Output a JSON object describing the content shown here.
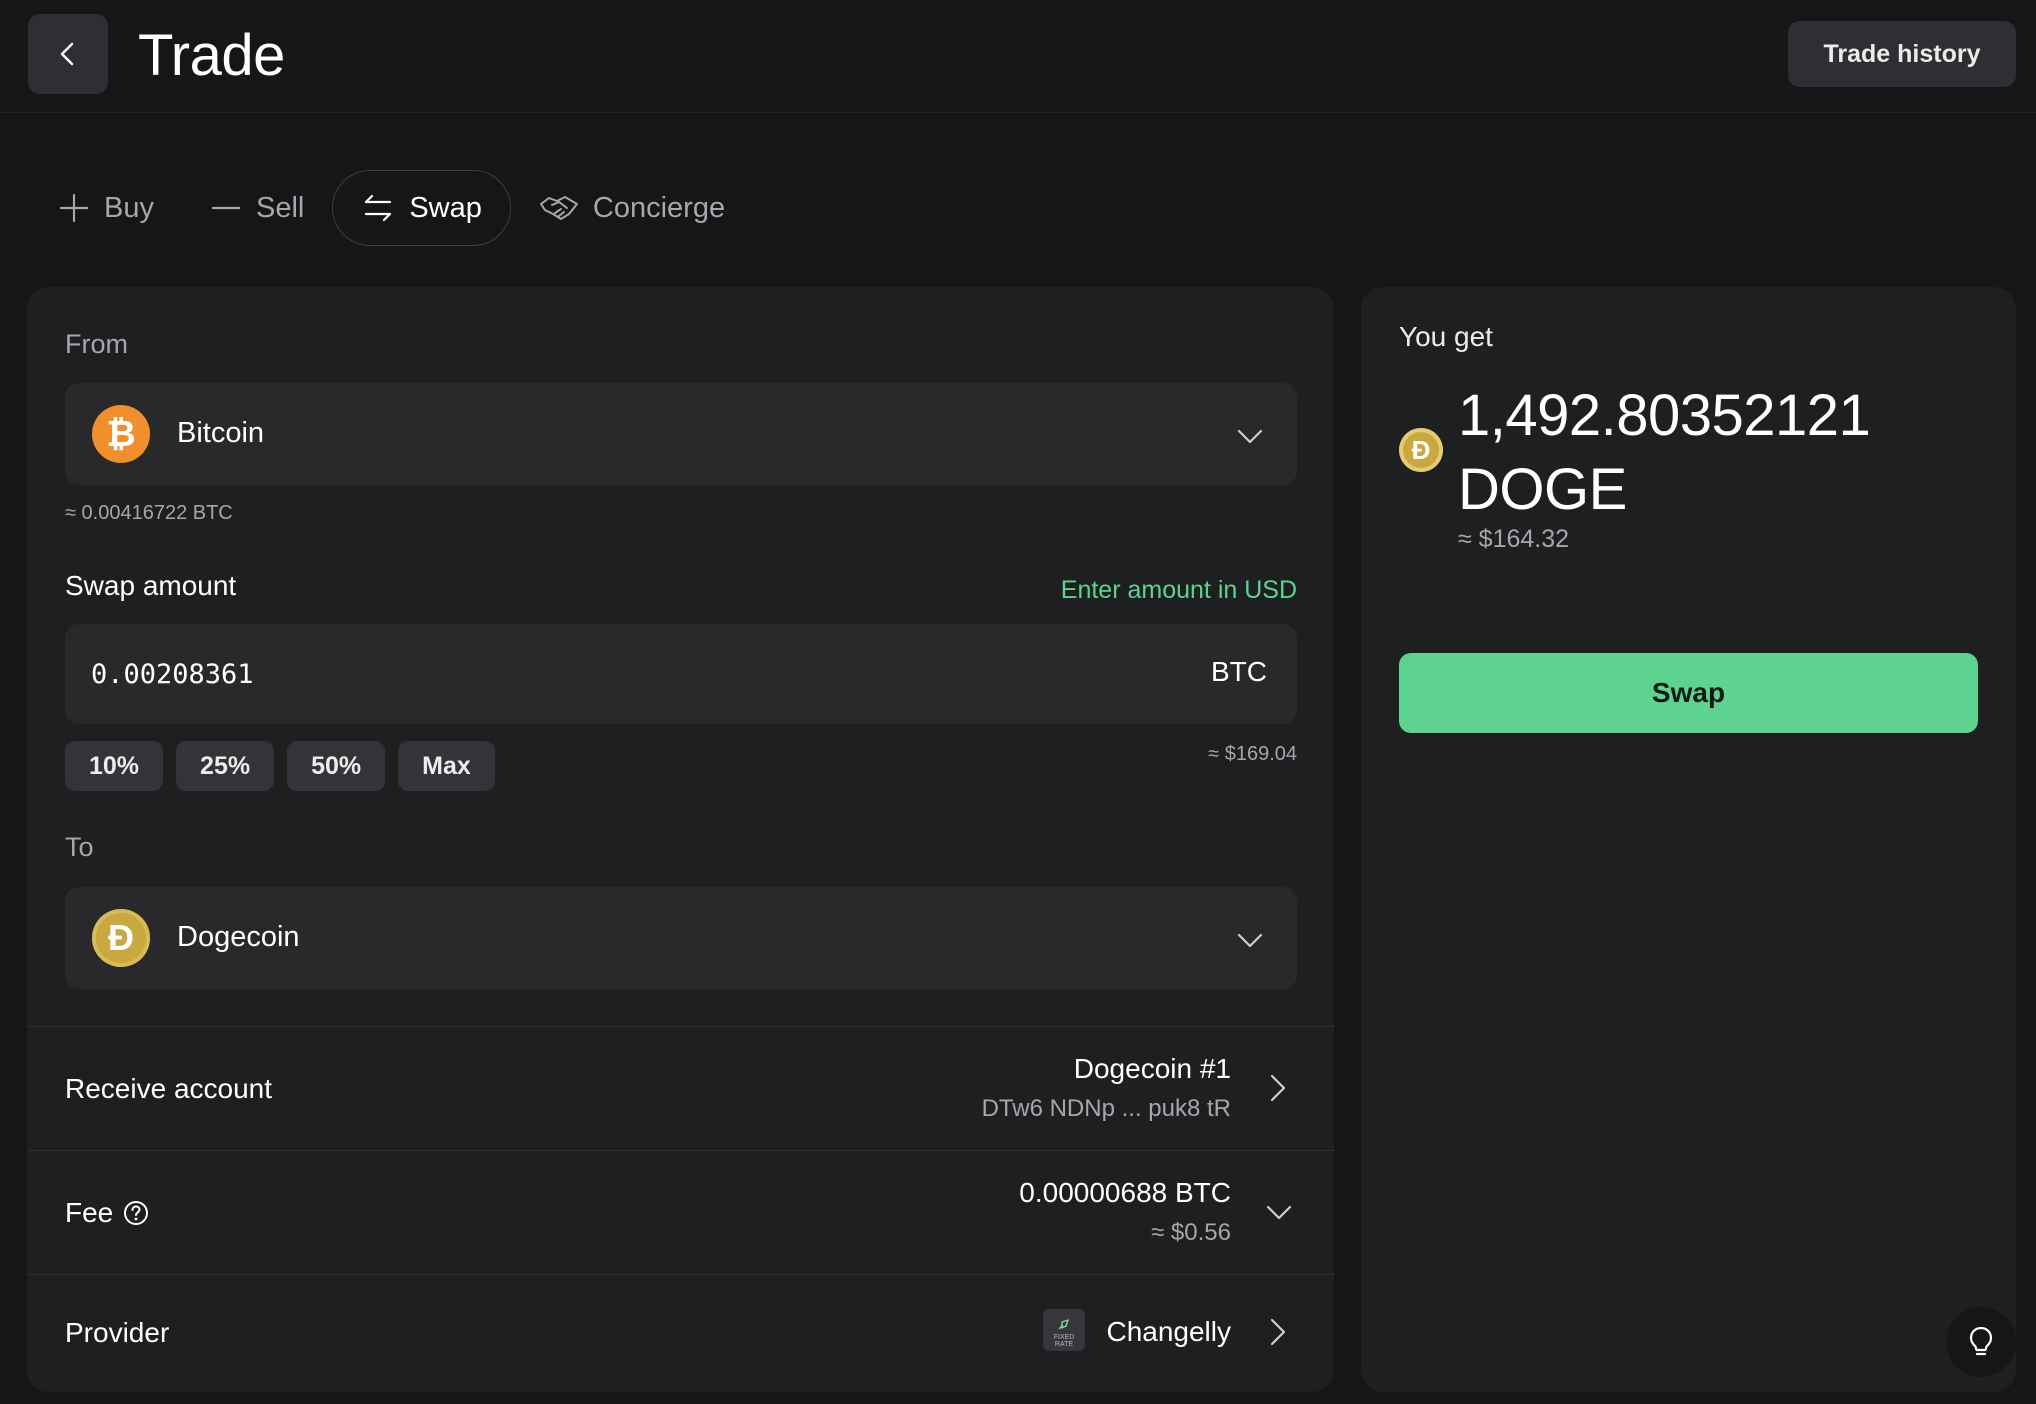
{
  "header": {
    "title": "Trade",
    "history_label": "Trade history"
  },
  "tabs": [
    {
      "label": "Buy",
      "icon": "plus-icon",
      "active": false
    },
    {
      "label": "Sell",
      "icon": "minus-icon",
      "active": false
    },
    {
      "label": "Swap",
      "icon": "swap-arrows-icon",
      "active": true
    },
    {
      "label": "Concierge",
      "icon": "handshake-icon",
      "active": false
    }
  ],
  "from": {
    "label": "From",
    "asset": "Bitcoin",
    "symbol_glyph": "₿",
    "balance": "≈ 0.00416722 BTC"
  },
  "swap_amount": {
    "label": "Swap amount",
    "usd_toggle": "Enter amount in USD",
    "value": "0.00208361",
    "unit": "BTC",
    "usd_value": "≈ $169.04",
    "presets": [
      "10%",
      "25%",
      "50%",
      "Max"
    ]
  },
  "to": {
    "label": "To",
    "asset": "Dogecoin",
    "symbol_glyph": "Đ"
  },
  "receive": {
    "label": "Receive account",
    "account": "Dogecoin #1",
    "address": "DTw6 NDNp ... puk8 tR"
  },
  "fee": {
    "label": "Fee",
    "amount": "0.00000688 BTC",
    "usd": "≈ $0.56"
  },
  "provider": {
    "label": "Provider",
    "name": "Changelly",
    "badge_line1": "FIXED",
    "badge_line2": "RATE"
  },
  "summary": {
    "label": "You get",
    "amount": "1,492.80352121",
    "unit": "DOGE",
    "usd": "≈ $164.32",
    "symbol_glyph": "Đ",
    "swap_label": "Swap"
  },
  "colors": {
    "accent": "#5ed38f",
    "bitcoin": "#f0902d",
    "dogecoin": "#c9a83f"
  }
}
